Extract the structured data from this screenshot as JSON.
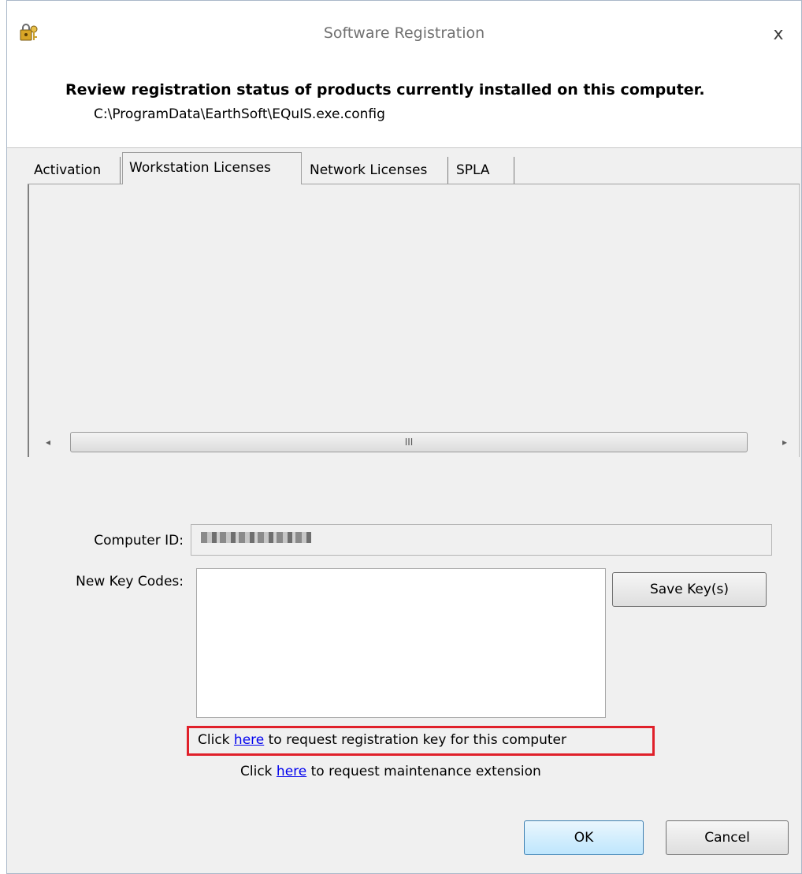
{
  "window": {
    "title": "Software Registration",
    "close_symbol": "x"
  },
  "header": {
    "title": "Review registration status of products currently installed on this computer.",
    "config_path": "C:\\ProgramData\\EarthSoft\\EQuIS.exe.config"
  },
  "tabs": [
    {
      "label": "Activation",
      "active": false
    },
    {
      "label": "Workstation Licenses",
      "active": true
    },
    {
      "label": "Network Licenses",
      "active": false
    },
    {
      "label": "SPLA",
      "active": false
    }
  ],
  "scrollbar": {
    "left_arrow": "◂",
    "right_arrow": "▸",
    "thumb_grip": "III"
  },
  "form": {
    "computer_id_label": "Computer ID:",
    "computer_id_value": "",
    "key_codes_label": "New Key Codes:",
    "key_codes_value": "",
    "save_button": "Save Key(s)"
  },
  "links": {
    "registration_prefix": "Click ",
    "registration_link": "here",
    "registration_suffix": " to request registration key for this computer",
    "maintenance_prefix": "Click ",
    "maintenance_link": "here",
    "maintenance_suffix": " to request maintenance extension"
  },
  "buttons": {
    "ok": "OK",
    "cancel": "Cancel"
  },
  "colors": {
    "highlight_box": "#e0202a",
    "link": "#0000ee"
  },
  "icons": {
    "app": "key-lock-icon",
    "close": "close-icon"
  }
}
